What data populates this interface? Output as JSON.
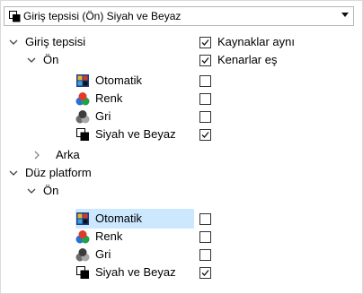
{
  "dropdown": {
    "selected": "Giriş tepsisi (Ön) Siyah ve Beyaz"
  },
  "settings": {
    "same_sources": {
      "label": "Kaynaklar aynı",
      "checked": true
    },
    "edges_equal": {
      "label": "Kenarlar eş",
      "checked": true
    }
  },
  "tree": {
    "input_tray": {
      "label": "Giriş tepsisi",
      "front": {
        "label": "Ön",
        "modes": [
          {
            "label": "Otomatik",
            "checked": false
          },
          {
            "label": "Renk",
            "checked": false
          },
          {
            "label": "Gri",
            "checked": false
          },
          {
            "label": "Siyah ve Beyaz",
            "checked": true
          }
        ]
      },
      "back": {
        "label": "Arka"
      }
    },
    "flatbed": {
      "label": "Düz platform",
      "front": {
        "label": "Ön",
        "modes": [
          {
            "label": "Otomatik",
            "checked": false,
            "selected": true
          },
          {
            "label": "Renk",
            "checked": false
          },
          {
            "label": "Gri",
            "checked": false
          },
          {
            "label": "Siyah ve Beyaz",
            "checked": true
          }
        ]
      }
    }
  }
}
